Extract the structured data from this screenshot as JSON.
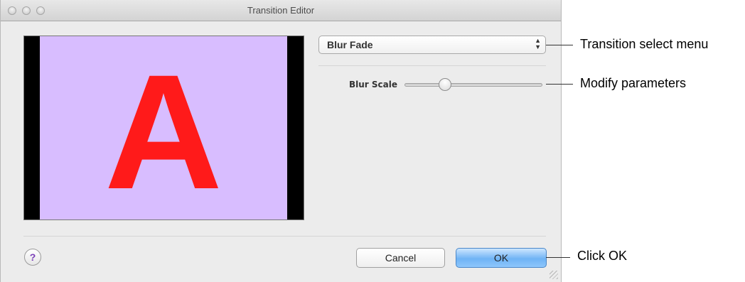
{
  "window": {
    "title": "Transition Editor"
  },
  "preview": {
    "letter": "A",
    "background_color": "#d8bdff",
    "letter_color": "#ff1a1a"
  },
  "transition_select": {
    "value": "Blur Fade"
  },
  "parameters": [
    {
      "label": "Blur Scale",
      "slider_value_fraction": 0.27
    }
  ],
  "buttons": {
    "help": "?",
    "cancel": "Cancel",
    "ok": "OK"
  },
  "callouts": {
    "select": "Transition select menu",
    "parameters": "Modify parameters",
    "ok": "Click OK"
  }
}
